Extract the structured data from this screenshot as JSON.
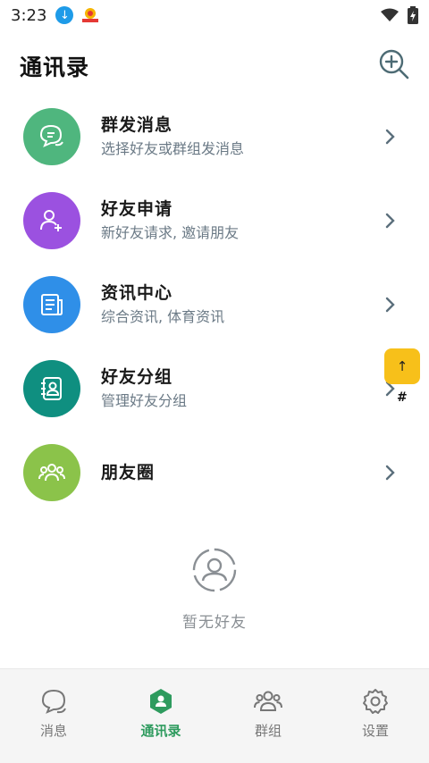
{
  "status_bar": {
    "time": "3:23"
  },
  "header": {
    "title": "通讯录"
  },
  "menu": [
    {
      "title": "群发消息",
      "subtitle": "选择好友或群组发消息",
      "color": "#4fb67e",
      "icon": "chat-icon"
    },
    {
      "title": "好友申请",
      "subtitle": "新好友请求, 邀请朋友",
      "color": "#9b51e0",
      "icon": "add-user-icon"
    },
    {
      "title": "资讯中心",
      "subtitle": "综合资讯, 体育资讯",
      "color": "#2f8fe8",
      "icon": "news-icon"
    },
    {
      "title": "好友分组",
      "subtitle": "管理好友分组",
      "color": "#0f8f80",
      "icon": "contact-book-icon"
    },
    {
      "title": "朋友圈",
      "subtitle": "",
      "color": "#8bc34a",
      "icon": "group-icon"
    }
  ],
  "floating": {
    "top_button": "↑",
    "hash": "#"
  },
  "empty_state": {
    "text": "暂无好友"
  },
  "tabs": [
    {
      "label": "消息",
      "icon": "message-icon",
      "active": false
    },
    {
      "label": "通讯录",
      "icon": "contacts-icon",
      "active": true
    },
    {
      "label": "群组",
      "icon": "group-icon",
      "active": false
    },
    {
      "label": "设置",
      "icon": "settings-icon",
      "active": false
    }
  ],
  "colors": {
    "accent": "#2e9b5e",
    "float": "#f7c01a"
  }
}
